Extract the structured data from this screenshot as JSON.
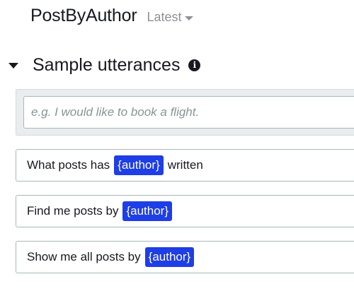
{
  "header": {
    "intent_name": "PostByAuthor",
    "version": "Latest"
  },
  "section": {
    "title": "Sample utterances"
  },
  "input": {
    "placeholder": "e.g. I would like to book a flight."
  },
  "utterances": [
    {
      "before": "What posts has",
      "slot": "{author}",
      "after": "written"
    },
    {
      "before": "Find me posts by",
      "slot": "{author}"
    },
    {
      "before": "Show me all posts by",
      "slot": "{author}"
    }
  ],
  "colors": {
    "slot_chip": "#1e3ee6",
    "input_area": "#eaeded",
    "version_text": "#8d9196"
  },
  "icons": {
    "version_dropdown": "caret-down-icon",
    "section_toggle": "caret-down-icon",
    "info": "info-icon"
  }
}
